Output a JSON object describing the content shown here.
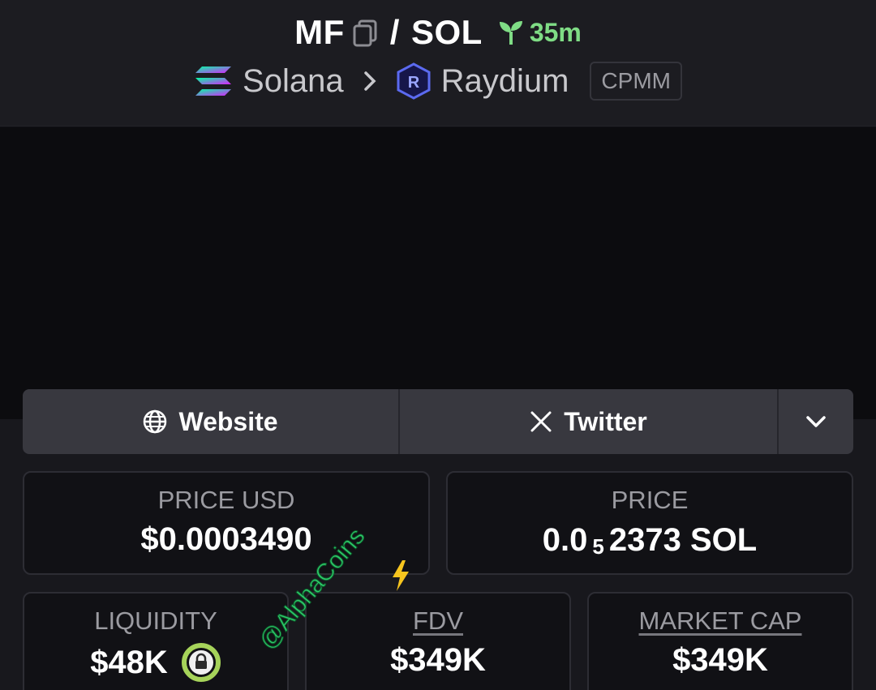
{
  "header": {
    "base_token": "MF",
    "separator": "/",
    "quote_token": "SOL",
    "age": "35m",
    "chain": "Solana",
    "dex": "Raydium",
    "pool_type": "CPMM"
  },
  "links": {
    "website_label": "Website",
    "twitter_label": "Twitter"
  },
  "stats": {
    "price_usd_label": "PRICE USD",
    "price_usd_value": "$0.0003490",
    "price_label": "PRICE",
    "price_prefix": "0.0",
    "price_zero_count": "5",
    "price_digits": "2373 SOL",
    "liquidity_label": "LIQUIDITY",
    "liquidity_value": "$48K",
    "fdv_label": "FDV",
    "fdv_value": "$349K",
    "mcap_label": "MARKET CAP",
    "mcap_value": "$349K"
  },
  "watermark": {
    "text": "@AlphaCoins"
  },
  "colors": {
    "age_green": "#7fdc85",
    "lock_green": "#a6d35a",
    "watermark_green": "#2ec96a"
  },
  "icons": [
    "copy-icon",
    "seedling-icon",
    "solana-icon",
    "chevron-right-icon",
    "raydium-icon",
    "globe-icon",
    "x-icon",
    "chevron-down-icon",
    "lock-icon",
    "lightning-icon"
  ]
}
